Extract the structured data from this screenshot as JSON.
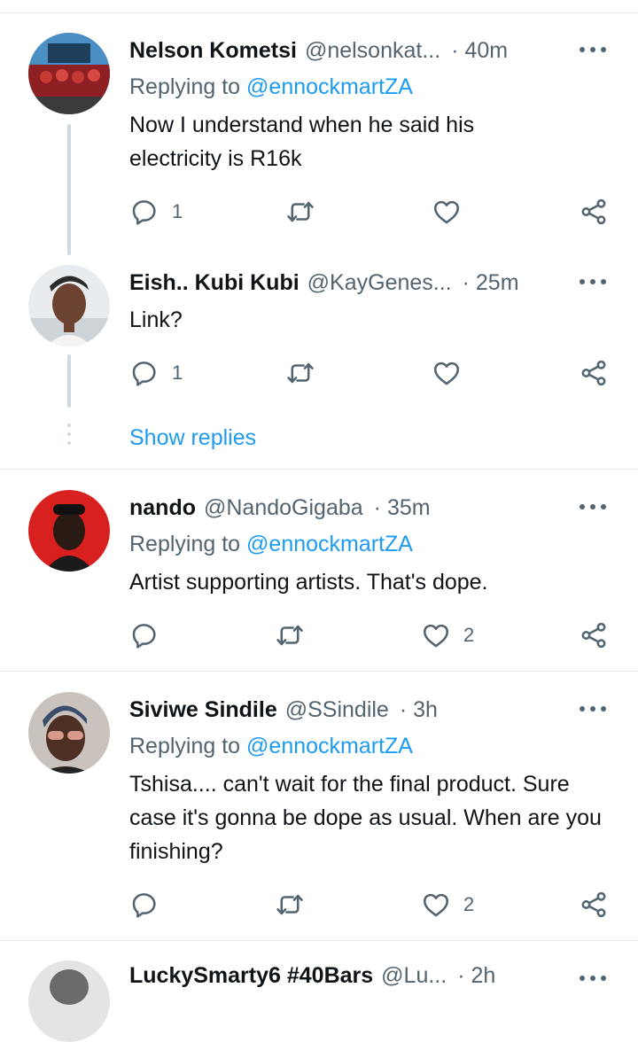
{
  "tweets": [
    {
      "name": "Nelson Kometsi",
      "handle": "@nelsonkat...",
      "time": "· 40m",
      "replying_label": "Replying to",
      "replying_handle": "@ennockmartZA",
      "text": "Now I understand when he said his electricity is R16k",
      "reply_count": "1",
      "retweet_count": "",
      "like_count": ""
    },
    {
      "name": "Eish.. Kubi Kubi",
      "handle": "@KayGenes...",
      "time": "· 25m",
      "text": "Link?",
      "reply_count": "1",
      "retweet_count": "",
      "like_count": ""
    },
    {
      "name": "nando",
      "handle": "@NandoGigaba",
      "time": "· 35m",
      "replying_label": "Replying to",
      "replying_handle": "@ennockmartZA",
      "text": "Artist supporting artists. That's dope.",
      "reply_count": "",
      "retweet_count": "",
      "like_count": "2"
    },
    {
      "name": "Siviwe Sindile",
      "handle": "@SSindile",
      "time": "· 3h",
      "replying_label": "Replying to",
      "replying_handle": "@ennockmartZA",
      "text": "Tshisa.... can't wait for the final product. Sure case it's gonna be dope as usual. When are you finishing?",
      "reply_count": "",
      "retweet_count": "",
      "like_count": "2"
    },
    {
      "name": "LuckySmarty6 #40Bars",
      "handle": "@Lu...",
      "time": "· 2h"
    }
  ],
  "show_replies": "Show replies",
  "icons": {
    "reply": "reply-icon",
    "retweet": "retweet-icon",
    "like": "heart-icon",
    "share": "share-icon",
    "more": "more-options-icon"
  },
  "colors": {
    "link": "#1d9bf0",
    "secondary_text": "#536471",
    "primary_text": "#0f1419",
    "divider": "#e6e9ea"
  }
}
